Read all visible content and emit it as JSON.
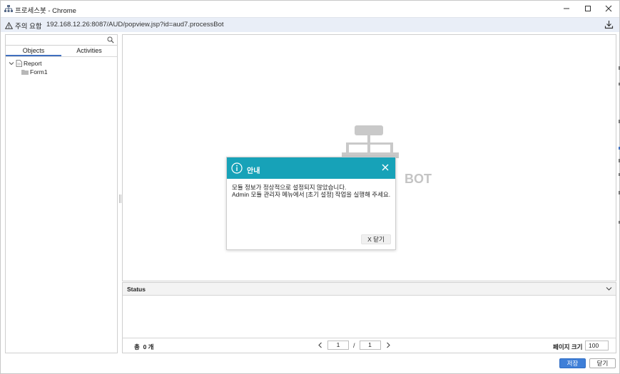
{
  "window": {
    "title": "프로세스봇 - Chrome",
    "minimize_icon": "minimize-icon",
    "maximize_icon": "maximize-icon",
    "close_icon": "close-icon"
  },
  "address_bar": {
    "security_label": "주의 요함",
    "url": "192.168.12.26:8087/AUD/popview.jsp?id=aud7.processBot"
  },
  "sidebar": {
    "search_placeholder": "",
    "tabs": [
      {
        "label": "Objects",
        "active": true
      },
      {
        "label": "Activities",
        "active": false
      }
    ],
    "tree": [
      {
        "label": "Report",
        "icon": "document-icon",
        "expanded": true
      },
      {
        "label": "Form1",
        "icon": "folder-icon"
      }
    ]
  },
  "canvas": {
    "watermark_text": "BOT"
  },
  "status": {
    "title": "Status",
    "total_label": "총",
    "total_count": "0",
    "total_unit": "개",
    "page_current": "1",
    "page_separator": "/",
    "page_total": "1",
    "page_size_label": "페이지 크기",
    "page_size_value": "100"
  },
  "buttons": {
    "save": "저장",
    "close": "닫기"
  },
  "modal": {
    "title": "안내",
    "message_line1": "모듈 정보가 정상적으로 설정되지 않았습니다.",
    "message_line2": "Admin 모듈 관리자 메뉴에서 [초기 설정] 작업을 실행해 주세요.",
    "close_button": "X 닫기"
  },
  "colors": {
    "modal_header": "#17a2b8",
    "primary_button": "#3f7fd8",
    "active_tab": "#3f6fbf"
  }
}
